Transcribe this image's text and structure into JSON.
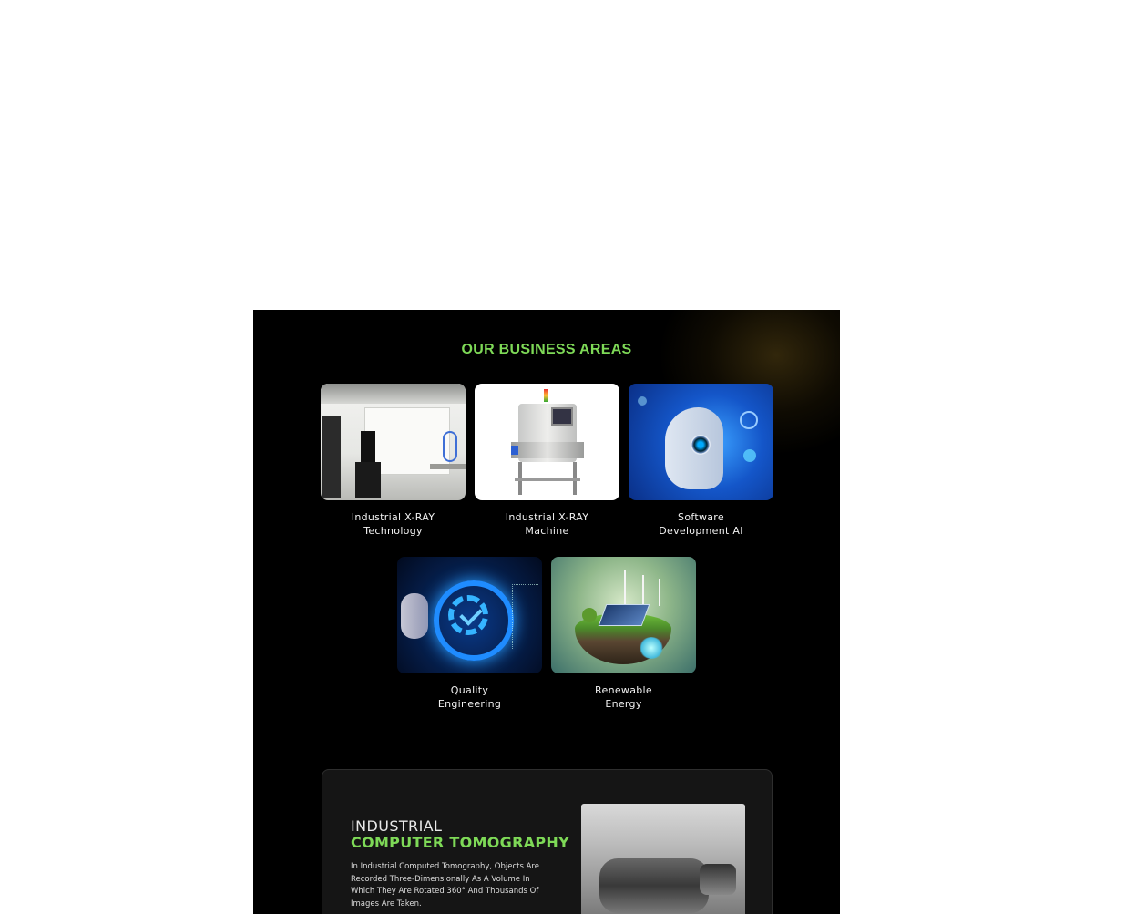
{
  "section": {
    "title": "OUR BUSINESS AREAS"
  },
  "areas": [
    {
      "line1": "Industrial X-RAY",
      "line2": "Technology",
      "image": "industrial-xray-lab-image"
    },
    {
      "line1": "Industrial X-RAY",
      "line2": "Machine",
      "image": "xray-machine-image"
    },
    {
      "line1": "Software",
      "line2": "Development AI",
      "image": "ai-robot-head-image"
    },
    {
      "line1": "Quality",
      "line2": "Engineering",
      "image": "quality-gear-image"
    },
    {
      "line1": "Renewable",
      "line2": "Energy",
      "image": "renewable-energy-image"
    }
  ],
  "ict": {
    "title_line1": "INDUSTRIAL",
    "title_line2": "COMPUTER TOMOGRAPHY",
    "description": "In Industrial Computed Tomography, Objects Are Recorded Three-Dimensionally As A Volume In Which They Are Rotated 360° And Thousands Of Images Are Taken.",
    "image": "ct-scan-image"
  },
  "colors": {
    "accent": "#7ed957",
    "panel_bg": "#000000",
    "card_bg": "#151515"
  }
}
